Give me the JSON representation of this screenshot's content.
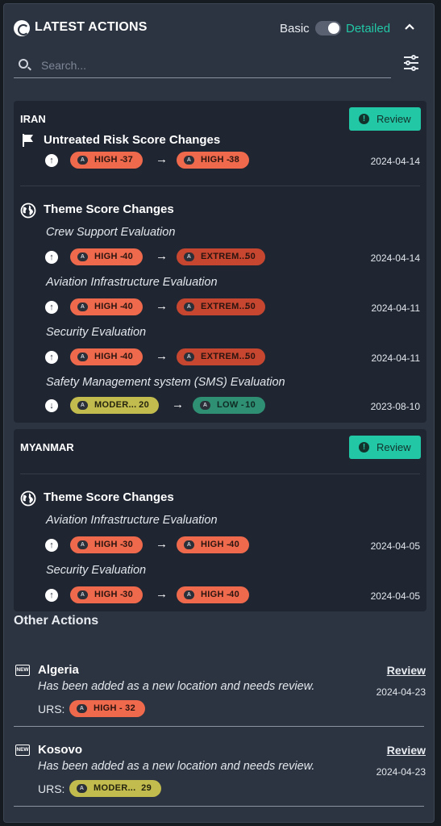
{
  "header": {
    "title": "LATEST ACTIONS",
    "mode_basic": "Basic",
    "mode_detailed": "Detailed",
    "collapse_icon": "chevron-up-icon",
    "search_placeholder": "Search...",
    "filter_icon": "sliders-icon",
    "toggle_state": "detailed"
  },
  "cards": [
    {
      "country": "IRAN",
      "review_label": "Review",
      "risk_section": {
        "title": "Untreated Risk Score Changes",
        "icon": "flag-icon",
        "change": {
          "direction": "up",
          "from_label": "HIGH -",
          "from_score": "37",
          "to_label": "HIGH -",
          "to_score": "38",
          "date": "2024-04-14"
        }
      },
      "theme_section": {
        "title": "Theme Score Changes",
        "icon": "globe-icon",
        "items": [
          {
            "name": "Crew Support Evaluation",
            "direction": "up",
            "from_label": "HIGH -",
            "from_score": "40",
            "to_label": "EXTREM...",
            "to_score": "50",
            "date": "2024-04-14"
          },
          {
            "name": "Aviation Infrastructure Evaluation",
            "direction": "up",
            "from_label": "HIGH -",
            "from_score": "40",
            "to_label": "EXTREM...",
            "to_score": "50",
            "date": "2024-04-11"
          },
          {
            "name": "Security Evaluation",
            "direction": "up",
            "from_label": "HIGH -",
            "from_score": "40",
            "to_label": "EXTREM...",
            "to_score": "50",
            "date": "2024-04-11"
          },
          {
            "name": "Safety Management system (SMS) Evaluation",
            "direction": "down",
            "from_label": "MODER...",
            "from_score": "20",
            "to_label": "LOW -",
            "to_score": "10",
            "date": "2023-08-10"
          }
        ]
      }
    },
    {
      "country": "MYANMAR",
      "review_label": "Review",
      "theme_section": {
        "title": "Theme Score Changes",
        "icon": "globe-icon",
        "items": [
          {
            "name": "Aviation Infrastructure Evaluation",
            "direction": "up",
            "from_label": "HIGH -",
            "from_score": "30",
            "to_label": "HIGH -",
            "to_score": "40",
            "date": "2024-04-05"
          },
          {
            "name": "Security Evaluation",
            "direction": "up",
            "from_label": "HIGH -",
            "from_score": "30",
            "to_label": "HIGH -",
            "to_score": "40",
            "date": "2024-04-05"
          }
        ]
      }
    }
  ],
  "pill_badge": "A",
  "other_actions": {
    "title": "Other Actions",
    "items": [
      {
        "name": "Algeria",
        "badge": "NEW",
        "description": "Has been added as a new location and needs review.",
        "urs_label": "URS:",
        "urs_level": "HIGH -",
        "urs_score": "32",
        "review_label": "Review",
        "date": "2024-04-23"
      },
      {
        "name": "Kosovo",
        "badge": "NEW",
        "description": "Has been added as a new location and needs review.",
        "urs_label": "URS:",
        "urs_level": "MODER...",
        "urs_score": "29",
        "review_label": "Review",
        "date": "2024-04-23"
      }
    ]
  },
  "colors": {
    "accent": "#22c7a6",
    "high": "#ef6a4c",
    "extreme": "#c7462f",
    "moderate": "#c2bb4d",
    "low": "#2f8f73"
  }
}
